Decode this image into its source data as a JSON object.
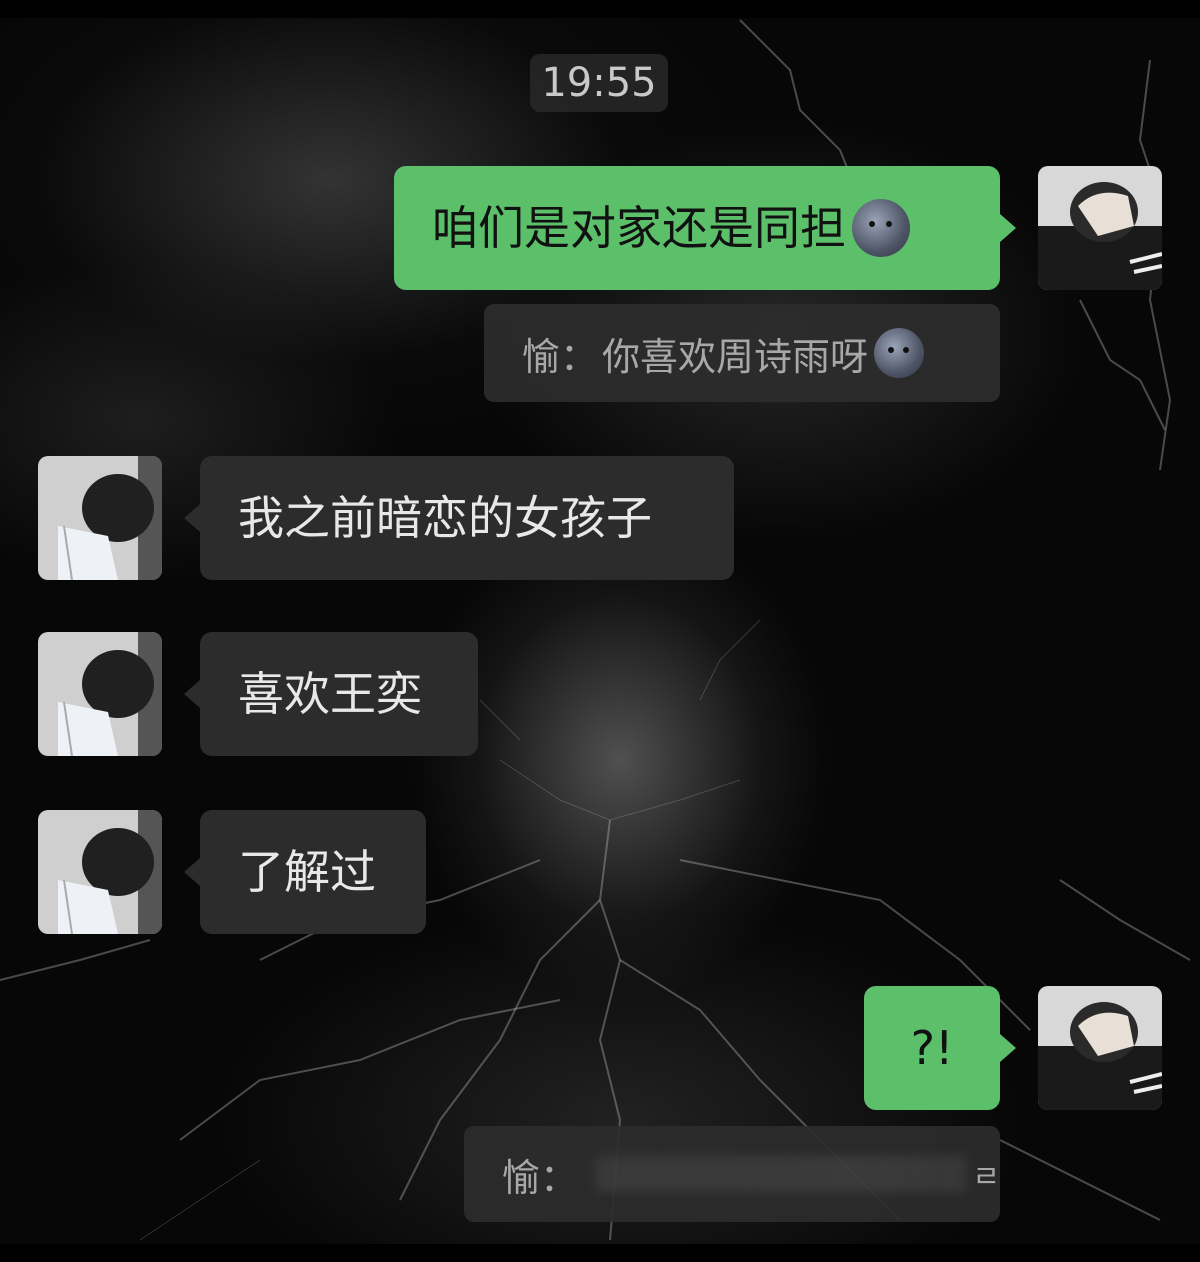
{
  "timestamp": "19:55",
  "messages": [
    {
      "side": "me",
      "text": "咱们是对家还是同担",
      "emoji": "new-moon-face"
    },
    {
      "quote_author": "愉：",
      "quote_text": "你喜欢周诗雨呀",
      "emoji": "new-moon-face"
    },
    {
      "side": "them",
      "text": "我之前暗恋的女孩子"
    },
    {
      "side": "them",
      "text": "喜欢王奕"
    },
    {
      "side": "them",
      "text": "了解过"
    },
    {
      "side": "me",
      "text": "?!"
    },
    {
      "quote_author": "愉：",
      "quote_text_visible": "ㄹ"
    }
  ],
  "colors": {
    "my_bubble": "#5cc06b",
    "their_bubble": "#2c2c2c",
    "background": "#070707"
  }
}
